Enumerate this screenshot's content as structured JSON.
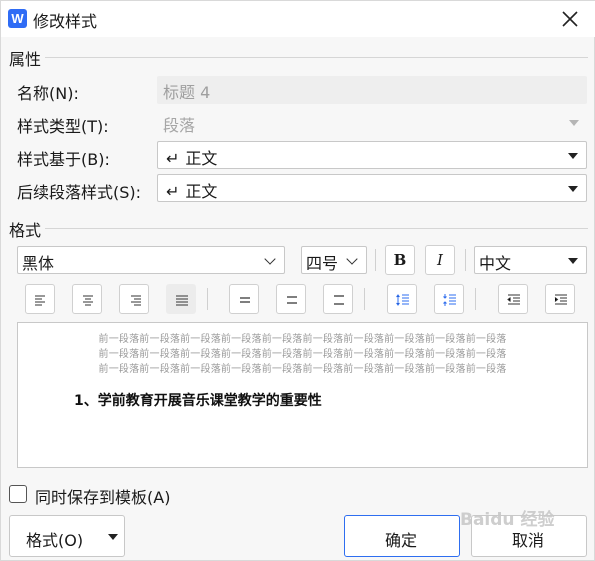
{
  "window": {
    "title": "修改样式",
    "app_icon_letter": "W"
  },
  "properties": {
    "section_title": "属性",
    "name": {
      "label": "名称(N):",
      "value": "标题 4"
    },
    "style_type": {
      "label": "样式类型(T):",
      "value": "段落"
    },
    "based_on": {
      "label": "样式基于(B):",
      "value": "正文"
    },
    "next_style": {
      "label": "后续段落样式(S):",
      "value": "正文"
    }
  },
  "format": {
    "section_title": "格式",
    "font": "黑体",
    "size": "四号",
    "bold_label": "B",
    "italic_label": "I",
    "language": "中文"
  },
  "preview": {
    "prev_lines": [
      "前一段落前一段落前一段落前一段落前一段落前一段落前一段落前一段落前一段落前一段落",
      "前一段落前一段落前一段落前一段落前一段落前一段落前一段落前一段落前一段落前一段落",
      "前一段落前一段落前一段落前一段落前一段落前一段落前一段落前一段落前一段落前一段落"
    ],
    "heading": "1、学前教育开展音乐课堂教学的重要性"
  },
  "save_to_template": {
    "label": "同时保存到模板(A)",
    "checked": false
  },
  "buttons": {
    "format": "格式(O)",
    "ok": "确定",
    "cancel": "取消"
  },
  "watermark": "Baidu 经验",
  "colors": {
    "accent": "#2e6ef0",
    "app_icon": "#2f6cf5"
  }
}
